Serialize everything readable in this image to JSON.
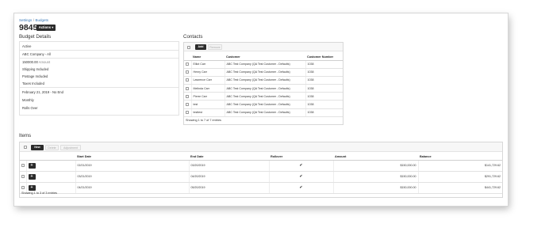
{
  "breadcrumb": [
    "Settings",
    "Budgets"
  ],
  "record_id": "9845",
  "actions_label": "Actions ▾",
  "budget_details": {
    "title": "Budget Details",
    "status": "Active",
    "company": "ABC Company - All",
    "amount_value": "150000.00",
    "amount_label": "Amount",
    "shipping": "Shipping Included",
    "postage": "Postage Included",
    "taxes": "Taxes Included",
    "date_range": "February 21, 2019 - No End",
    "frequency": "Monthly",
    "rollover": "Rolls Over"
  },
  "contacts": {
    "title": "Contacts",
    "add_label": "Add",
    "remove_label": "Remove",
    "columns": [
      "Name",
      "Customer",
      "Customer Number"
    ],
    "rows": [
      [
        "Elliot Carr",
        "ABC Test Company (QA Test Customer - Defaults)",
        "1038"
      ],
      [
        "Henry Carr",
        "ABC Test Company (QA Test Customer - Defaults)",
        "1038"
      ],
      [
        "Lawrence Carr",
        "ABC Test Company (QA Test Customer - Defaults)",
        "1038"
      ],
      [
        "Melinda Carr",
        "ABC Test Company (QA Test Customer - Defaults)",
        "1038"
      ],
      [
        "Pierre Carr",
        "ABC Test Company (QA Test Customer - Defaults)",
        "1038"
      ],
      [
        "test",
        "ABC Test Company (QA Test Customer - Defaults)",
        "1038"
      ],
      [
        "testtest",
        "ABC Test Company (QA Test Customer - Defaults)",
        "1038"
      ]
    ],
    "footer": "Showing 1 to 7 of 7 entries"
  },
  "items": {
    "title": "Items",
    "new_label": "New",
    "delete_label": "Delete",
    "adjustment_label": "Adjustment",
    "columns": [
      "Start Date",
      "End Date",
      "Rollover",
      "Amount",
      "Balance"
    ],
    "rows": [
      {
        "start": "02/21/2019",
        "end": "03/20/2019",
        "rollover": true,
        "amount": "$150,000.00",
        "balance": "$141,729.62"
      },
      {
        "start": "03/21/2019",
        "end": "04/20/2019",
        "rollover": true,
        "amount": "$150,000.00",
        "balance": "$291,729.62"
      },
      {
        "start": "04/21/2019",
        "end": "05/20/2019",
        "rollover": true,
        "amount": "$150,000.00",
        "balance": "$441,729.62"
      }
    ],
    "footer": "Showing 1 to 3 of 3 entries"
  },
  "icons": {
    "check": "check-icon",
    "plus": "plus-icon",
    "dropdown": "caret-down-icon"
  }
}
